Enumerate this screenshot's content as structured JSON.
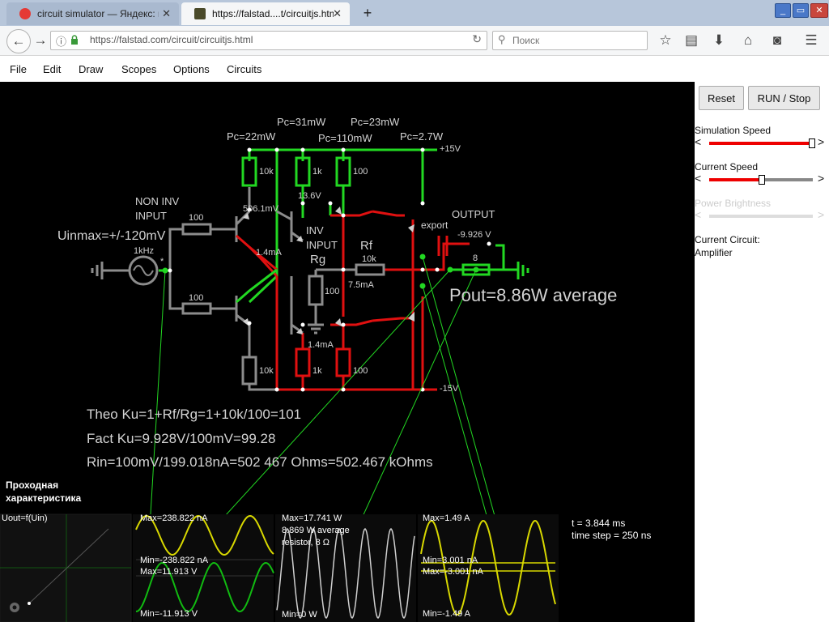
{
  "browser": {
    "tabs": [
      {
        "title": "circuit simulator — Яндекс: н...",
        "active": false
      },
      {
        "title": "https://falstad....t/circuitjs.html",
        "active": true
      }
    ],
    "url": "https://falstad.com/circuit/circuitjs.html",
    "search_placeholder": "Поиск",
    "new_tab": "+",
    "close_tab": "✕",
    "window_buttons": {
      "minimize": "_",
      "maximize": "▭",
      "close": "✕"
    }
  },
  "menu": {
    "items": [
      "File",
      "Edit",
      "Draw",
      "Scopes",
      "Options",
      "Circuits"
    ]
  },
  "circuit": {
    "labels": {
      "pc_22": "Pc=22mW",
      "pc_31": "Pc=31mW",
      "pc_110": "Pc=110mW",
      "pc_23": "Pc=23mW",
      "pc_2_7": "Pc=2.7W",
      "plus15": "+15V",
      "minus15": "-15V",
      "non_inv": "NON INV",
      "input1": "INPUT",
      "inv": "INV",
      "input2": "INPUT",
      "output": "OUTPUT",
      "uin": "Uinmax=+/-120mV",
      "freq": "1kHz",
      "r100_top": "100",
      "r100_bot": "100",
      "r10k_left_top": "10k",
      "r1k_top": "1k",
      "r100_top2": "100",
      "v13_6": "13.6V",
      "v506": "506.1mV",
      "i14_top": "1.4mA",
      "rf": "Rf",
      "rf_val": "10k",
      "rg": "Rg",
      "rg_val": "100",
      "i7_5": "7.5mA",
      "export": "export",
      "out_v": "-9.926 V",
      "rload": "8",
      "pout": "Pout=8.86W average",
      "i14_bot": "1.4mA",
      "r10k_bot": "10k",
      "r1k_bot": "1k",
      "r100_bot2": "100",
      "theo": "Theo Ku=1+Rf/Rg=1+10k/100=101",
      "fact": "Fact Ku=9.928V/100mV=99.28",
      "rin": "Rin=100mV/199.018nA=502 467 Ohms=502.467 kOhms",
      "transfer1": "Проходная",
      "transfer2": "характеристика",
      "star": "*"
    }
  },
  "scopes": {
    "s1_title": "Uout=f(Uin)",
    "s2_max_i": "Max=238.822 nA",
    "s2_min_i": "Min=-238.822 nA",
    "s2_max_v": "Max=11.913 V",
    "s2_min_v": "Min=-11.913 V",
    "s3_max": "Max=17.741 W",
    "s3_avg": "8.869 W average",
    "s3_res": "resistor, 8 Ω",
    "s3_min": "Min=0 W",
    "s4_max": "Max=1.49 A",
    "s4_min_i": "Min=3.001 nA",
    "s4_max_i": "Max=-3.001 nA",
    "s4_min": "Min=-1.49 A",
    "time": "t = 3.844 ms",
    "step": "time step = 250 ns"
  },
  "panel": {
    "reset": "Reset",
    "run": "RUN",
    "run_sep": " / ",
    "stop": "Stop",
    "sim_speed_label": "Simulation Speed",
    "sim_speed_value": 0.99,
    "current_speed_label": "Current Speed",
    "current_speed_value": 0.51,
    "power_brightness_label": "Power Brightness",
    "current_circuit_label": "Current Circuit:",
    "current_circuit_name": "Amplifier"
  },
  "colors": {
    "wire_green": "#22d822",
    "wire_red": "#e01010",
    "wire_gray": "#8c8c8c",
    "text": "#d3d3d3",
    "scope_yellow": "#d8d800",
    "scope_green": "#11bb11",
    "scope_white": "#cfcfcf"
  }
}
